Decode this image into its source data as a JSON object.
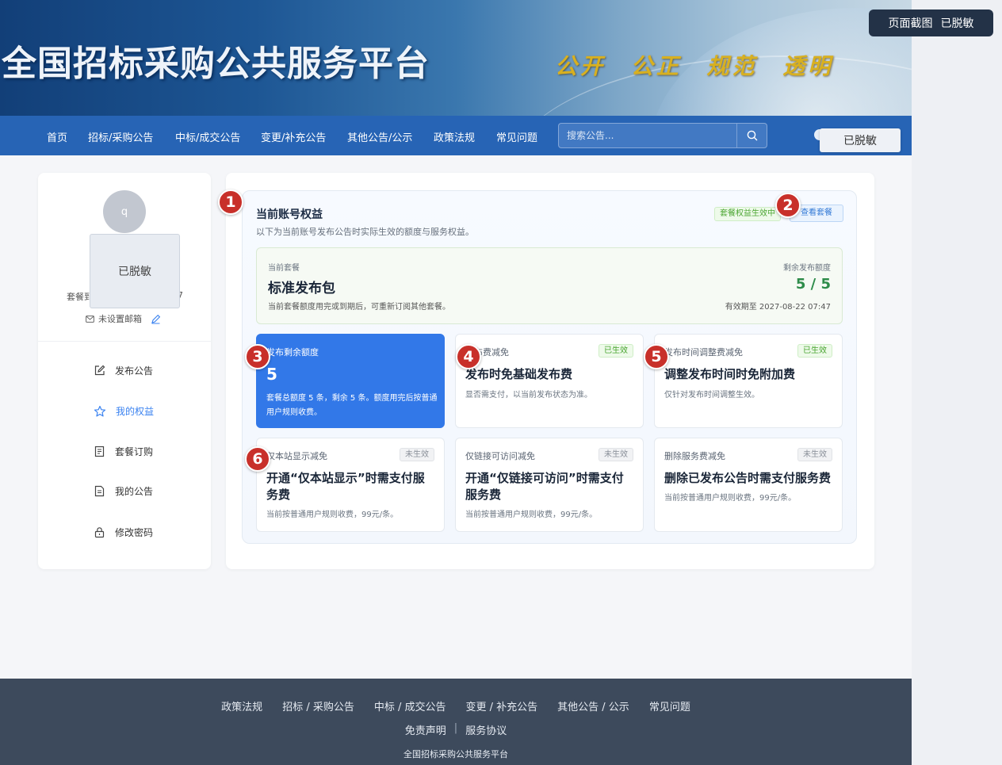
{
  "screenshot_badge": {
    "label": "页面截图",
    "status": "已脱敏"
  },
  "banner": {
    "title": "全国招标采购公共服务平台",
    "slogan": "公开 公正 规范 透明"
  },
  "nav": {
    "items": [
      "首页",
      "招标/采购公告",
      "中标/成交公告",
      "变更/补充公告",
      "其他公告/公示",
      "政策法规",
      "常见问题"
    ],
    "search_placeholder": "搜索公告...",
    "user_badge": "已脱敏"
  },
  "sidebar": {
    "avatar_letter": "q",
    "user_card": "已脱敏",
    "subscription_prefix": "套餐到",
    "subscription_tail": "7",
    "email": "未设置邮箱",
    "menu": [
      "发布公告",
      "我的权益",
      "套餐订购",
      "我的公告",
      "修改密码"
    ],
    "active_index": 1
  },
  "rights": {
    "title": "当前账号权益",
    "description": "以下为当前账号发布公告时实际生效的额度与服务权益。",
    "status_tag": "套餐权益生效中",
    "view_button": "查看套餐",
    "plan": {
      "label": "当前套餐",
      "name": "标准发布包",
      "note": "当前套餐额度用完或到期后，可重新订阅其他套餐。",
      "quota_label": "剩余发布额度",
      "quota": "5 / 5",
      "expiry": "有效期至 2027-08-22 07:47"
    },
    "cards": [
      {
        "label": "发布剩余额度",
        "big": "5",
        "note": "套餐总额度 5 条，剩余 5 条。额度用完后按普通用户规则收费。"
      },
      {
        "label": "发布费减免",
        "tag": "已生效",
        "title": "发布时免基础发布费",
        "note": "显否需支付，以当前发布状态为准。"
      },
      {
        "label": "发布时间调整费减免",
        "tag": "已生效",
        "title": "调整发布时间时免附加费",
        "note": "仅针对发布时间调整生效。"
      },
      {
        "label": "仅本站显示减免",
        "tag": "未生效",
        "title": "开通“仅本站显示”时需支付服务费",
        "note": "当前按普通用户规则收费，99元/条。"
      },
      {
        "label": "仅链接可访问减免",
        "tag": "未生效",
        "title": "开通“仅链接可访问”时需支付服务费",
        "note": "当前按普通用户规则收费，99元/条。"
      },
      {
        "label": "删除服务费减免",
        "tag": "未生效",
        "title": "删除已发布公告时需支付服务费",
        "note": "当前按普通用户规则收费，99元/条。"
      }
    ]
  },
  "markers": [
    "1",
    "2",
    "3",
    "4",
    "5",
    "6"
  ],
  "footer": {
    "links": [
      "政策法规",
      "招标 / 采购公告",
      "中标 / 成交公告",
      "变更 / 补充公告",
      "其他公告 / 公示",
      "常见问题"
    ],
    "disclaimer": "免责声明",
    "separator": "|",
    "agreement": "服务协议",
    "copyright": "全国招标采购公共服务平台"
  },
  "colors": {
    "nav": "#2764b5",
    "accent": "#3278e8",
    "active_green": "#4aa531",
    "marker_red": "#c8302a",
    "footer": "#3d4a5c"
  }
}
